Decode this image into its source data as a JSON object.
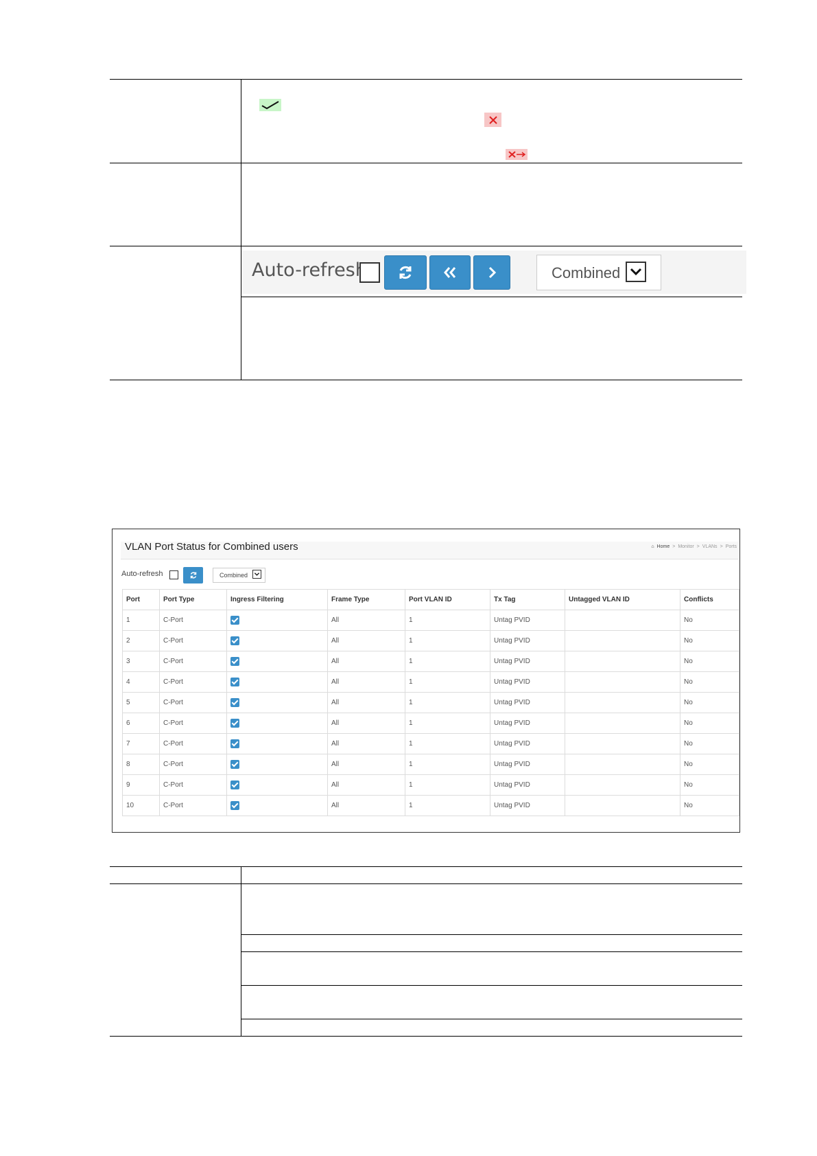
{
  "toolbar_large": {
    "auto_refresh_label": "Auto-refresh",
    "select_value": "Combined",
    "buttons": [
      "refresh-icon",
      "first-page-icon",
      "next-page-icon"
    ]
  },
  "panel": {
    "title": "VLAN Port Status for Combined users",
    "breadcrumb": [
      "Home",
      ">",
      "Monitor",
      ">",
      "VLANs",
      ">",
      "Ports"
    ],
    "auto_refresh_label": "Auto-refresh",
    "select_value": "Combined",
    "table": {
      "headers": [
        "Port",
        "Port Type",
        "Ingress Filtering",
        "Frame Type",
        "Port VLAN ID",
        "Tx Tag",
        "Untagged VLAN ID",
        "Conflicts"
      ],
      "rows": [
        {
          "port": "1",
          "type": "C-Port",
          "frame": "All",
          "pvid": "1",
          "tx": "Untag PVID",
          "untagged": "",
          "conflicts": "No"
        },
        {
          "port": "2",
          "type": "C-Port",
          "frame": "All",
          "pvid": "1",
          "tx": "Untag PVID",
          "untagged": "",
          "conflicts": "No"
        },
        {
          "port": "3",
          "type": "C-Port",
          "frame": "All",
          "pvid": "1",
          "tx": "Untag PVID",
          "untagged": "",
          "conflicts": "No"
        },
        {
          "port": "4",
          "type": "C-Port",
          "frame": "All",
          "pvid": "1",
          "tx": "Untag PVID",
          "untagged": "",
          "conflicts": "No"
        },
        {
          "port": "5",
          "type": "C-Port",
          "frame": "All",
          "pvid": "1",
          "tx": "Untag PVID",
          "untagged": "",
          "conflicts": "No"
        },
        {
          "port": "6",
          "type": "C-Port",
          "frame": "All",
          "pvid": "1",
          "tx": "Untag PVID",
          "untagged": "",
          "conflicts": "No"
        },
        {
          "port": "7",
          "type": "C-Port",
          "frame": "All",
          "pvid": "1",
          "tx": "Untag PVID",
          "untagged": "",
          "conflicts": "No"
        },
        {
          "port": "8",
          "type": "C-Port",
          "frame": "All",
          "pvid": "1",
          "tx": "Untag PVID",
          "untagged": "",
          "conflicts": "No"
        },
        {
          "port": "9",
          "type": "C-Port",
          "frame": "All",
          "pvid": "1",
          "tx": "Untag PVID",
          "untagged": "",
          "conflicts": "No"
        },
        {
          "port": "10",
          "type": "C-Port",
          "frame": "All",
          "pvid": "1",
          "tx": "Untag PVID",
          "untagged": "",
          "conflicts": "No"
        }
      ]
    }
  },
  "colors": {
    "button_blue": "#3a8fc9",
    "ok_bg": "#c8f5c8",
    "error_bg": "#f7c6c6"
  }
}
